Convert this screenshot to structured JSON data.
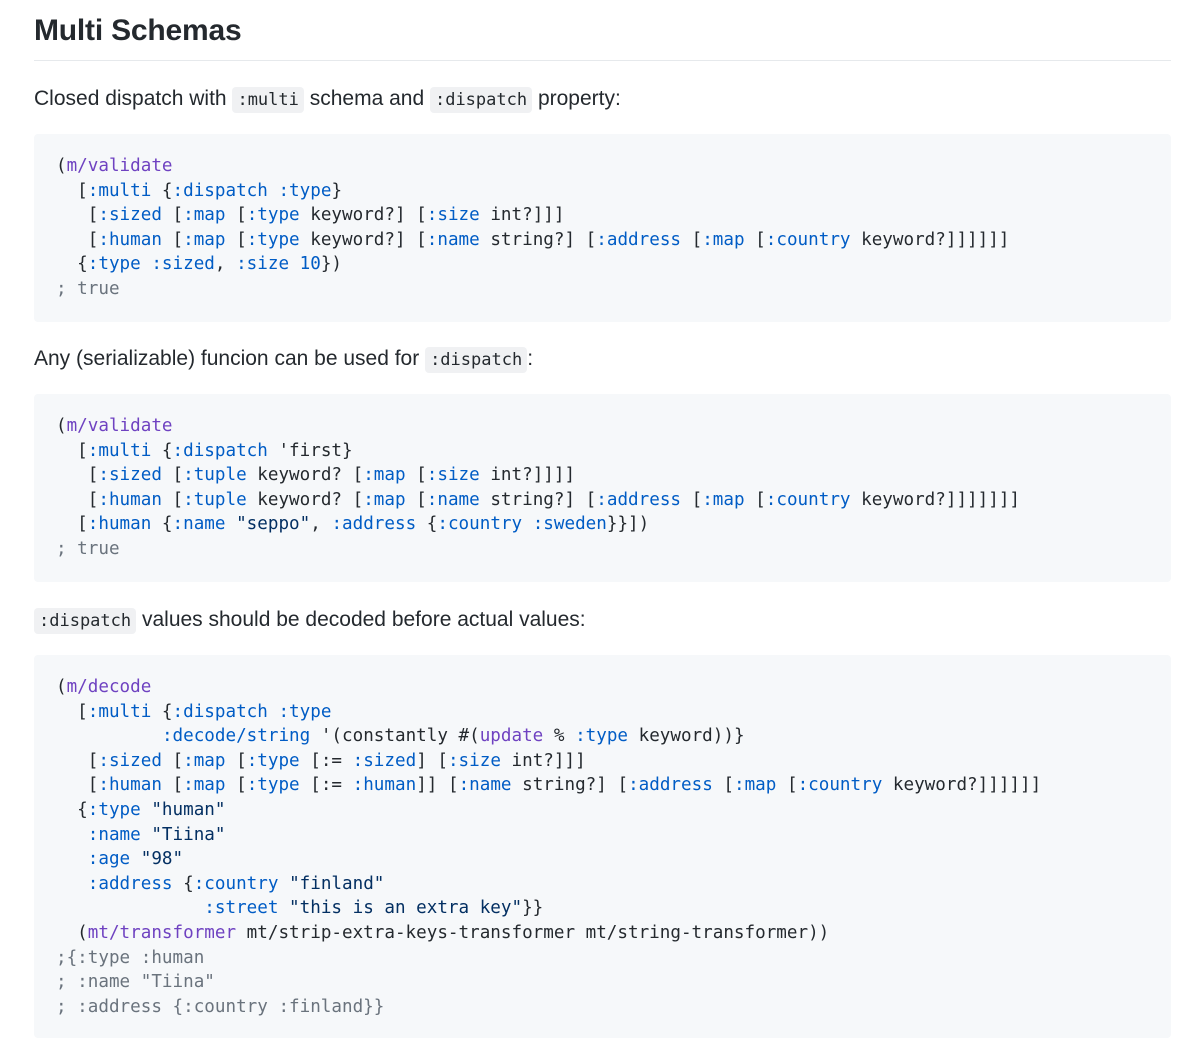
{
  "heading": "Multi Schemas",
  "para1": {
    "before": "Closed dispatch with",
    "code1": ":multi",
    "middle": "schema and",
    "code2": ":dispatch",
    "after": "property:"
  },
  "para2": {
    "before": "Any (serializable) funcion can be used for",
    "code1": ":dispatch",
    "after": ":"
  },
  "para3": {
    "code1": ":dispatch",
    "after": "values should be decoded before actual values:"
  },
  "code_blocks": [
    {
      "lines": [
        [
          [
            "p",
            "("
          ],
          [
            "f",
            "m/validate"
          ]
        ],
        [
          [
            "p",
            "  ["
          ],
          [
            "k",
            ":multi"
          ],
          [
            "p",
            " {"
          ],
          [
            "k",
            ":dispatch"
          ],
          [
            "p",
            " "
          ],
          [
            "k",
            ":type"
          ],
          [
            "p",
            "}"
          ]
        ],
        [
          [
            "p",
            "   ["
          ],
          [
            "k",
            ":sized"
          ],
          [
            "p",
            " ["
          ],
          [
            "k",
            ":map"
          ],
          [
            "p",
            " ["
          ],
          [
            "k",
            ":type"
          ],
          [
            "p",
            " keyword?] ["
          ],
          [
            "k",
            ":size"
          ],
          [
            "p",
            " int?]]]"
          ]
        ],
        [
          [
            "p",
            "   ["
          ],
          [
            "k",
            ":human"
          ],
          [
            "p",
            " ["
          ],
          [
            "k",
            ":map"
          ],
          [
            "p",
            " ["
          ],
          [
            "k",
            ":type"
          ],
          [
            "p",
            " keyword?] ["
          ],
          [
            "k",
            ":name"
          ],
          [
            "p",
            " string?] ["
          ],
          [
            "k",
            ":address"
          ],
          [
            "p",
            " ["
          ],
          [
            "k",
            ":map"
          ],
          [
            "p",
            " ["
          ],
          [
            "k",
            ":country"
          ],
          [
            "p",
            " keyword?]]]]]]"
          ]
        ],
        [
          [
            "p",
            "  {"
          ],
          [
            "k",
            ":type"
          ],
          [
            "p",
            " "
          ],
          [
            "k",
            ":sized"
          ],
          [
            "p",
            ", "
          ],
          [
            "k",
            ":size"
          ],
          [
            "p",
            " "
          ],
          [
            "n",
            "10"
          ],
          [
            "p",
            "})"
          ]
        ],
        [
          [
            "c",
            "; true"
          ]
        ]
      ]
    },
    {
      "lines": [
        [
          [
            "p",
            "("
          ],
          [
            "f",
            "m/validate"
          ]
        ],
        [
          [
            "p",
            "  ["
          ],
          [
            "k",
            ":multi"
          ],
          [
            "p",
            " {"
          ],
          [
            "k",
            ":dispatch"
          ],
          [
            "p",
            " 'first}"
          ]
        ],
        [
          [
            "p",
            "   ["
          ],
          [
            "k",
            ":sized"
          ],
          [
            "p",
            " ["
          ],
          [
            "k",
            ":tuple"
          ],
          [
            "p",
            " keyword? ["
          ],
          [
            "k",
            ":map"
          ],
          [
            "p",
            " ["
          ],
          [
            "k",
            ":size"
          ],
          [
            "p",
            " int?]]]]"
          ]
        ],
        [
          [
            "p",
            "   ["
          ],
          [
            "k",
            ":human"
          ],
          [
            "p",
            " ["
          ],
          [
            "k",
            ":tuple"
          ],
          [
            "p",
            " keyword? ["
          ],
          [
            "k",
            ":map"
          ],
          [
            "p",
            " ["
          ],
          [
            "k",
            ":name"
          ],
          [
            "p",
            " string?] ["
          ],
          [
            "k",
            ":address"
          ],
          [
            "p",
            " ["
          ],
          [
            "k",
            ":map"
          ],
          [
            "p",
            " ["
          ],
          [
            "k",
            ":country"
          ],
          [
            "p",
            " keyword?]]]]]]]"
          ]
        ],
        [
          [
            "p",
            "  ["
          ],
          [
            "k",
            ":human"
          ],
          [
            "p",
            " {"
          ],
          [
            "k",
            ":name"
          ],
          [
            "p",
            " "
          ],
          [
            "s",
            "\"seppo\""
          ],
          [
            "p",
            ", "
          ],
          [
            "k",
            ":address"
          ],
          [
            "p",
            " {"
          ],
          [
            "k",
            ":country"
          ],
          [
            "p",
            " "
          ],
          [
            "k",
            ":sweden"
          ],
          [
            "p",
            "}}])"
          ]
        ],
        [
          [
            "c",
            "; true"
          ]
        ]
      ]
    },
    {
      "lines": [
        [
          [
            "p",
            "("
          ],
          [
            "f",
            "m/decode"
          ]
        ],
        [
          [
            "p",
            "  ["
          ],
          [
            "k",
            ":multi"
          ],
          [
            "p",
            " {"
          ],
          [
            "k",
            ":dispatch"
          ],
          [
            "p",
            " "
          ],
          [
            "k",
            ":type"
          ]
        ],
        [
          [
            "p",
            "          "
          ],
          [
            "k",
            ":decode/string"
          ],
          [
            "p",
            " '(constantly #("
          ],
          [
            "f",
            "update"
          ],
          [
            "p",
            " % "
          ],
          [
            "k",
            ":type"
          ],
          [
            "p",
            " keyword))}"
          ]
        ],
        [
          [
            "p",
            "   ["
          ],
          [
            "k",
            ":sized"
          ],
          [
            "p",
            " ["
          ],
          [
            "k",
            ":map"
          ],
          [
            "p",
            " ["
          ],
          [
            "k",
            ":type"
          ],
          [
            "p",
            " [:= "
          ],
          [
            "k",
            ":sized"
          ],
          [
            "p",
            "] ["
          ],
          [
            "k",
            ":size"
          ],
          [
            "p",
            " int?]]]"
          ]
        ],
        [
          [
            "p",
            "   ["
          ],
          [
            "k",
            ":human"
          ],
          [
            "p",
            " ["
          ],
          [
            "k",
            ":map"
          ],
          [
            "p",
            " ["
          ],
          [
            "k",
            ":type"
          ],
          [
            "p",
            " [:= "
          ],
          [
            "k",
            ":human"
          ],
          [
            "p",
            "]] ["
          ],
          [
            "k",
            ":name"
          ],
          [
            "p",
            " string?] ["
          ],
          [
            "k",
            ":address"
          ],
          [
            "p",
            " ["
          ],
          [
            "k",
            ":map"
          ],
          [
            "p",
            " ["
          ],
          [
            "k",
            ":country"
          ],
          [
            "p",
            " keyword?]]]]]]"
          ]
        ],
        [
          [
            "p",
            "  {"
          ],
          [
            "k",
            ":type"
          ],
          [
            "p",
            " "
          ],
          [
            "s",
            "\"human\""
          ]
        ],
        [
          [
            "p",
            "   "
          ],
          [
            "k",
            ":name"
          ],
          [
            "p",
            " "
          ],
          [
            "s",
            "\"Tiina\""
          ]
        ],
        [
          [
            "p",
            "   "
          ],
          [
            "k",
            ":age"
          ],
          [
            "p",
            " "
          ],
          [
            "s",
            "\"98\""
          ]
        ],
        [
          [
            "p",
            "   "
          ],
          [
            "k",
            ":address"
          ],
          [
            "p",
            " {"
          ],
          [
            "k",
            ":country"
          ],
          [
            "p",
            " "
          ],
          [
            "s",
            "\"finland\""
          ]
        ],
        [
          [
            "p",
            "              "
          ],
          [
            "k",
            ":street"
          ],
          [
            "p",
            " "
          ],
          [
            "s",
            "\"this is an extra key\""
          ],
          [
            "p",
            "}}"
          ]
        ],
        [
          [
            "p",
            "  ("
          ],
          [
            "f",
            "mt/transformer"
          ],
          [
            "p",
            " mt/strip-extra-keys-transformer mt/string-transformer))"
          ]
        ],
        [
          [
            "c",
            ";{:type :human"
          ]
        ],
        [
          [
            "c",
            "; :name \"Tiina\""
          ]
        ],
        [
          [
            "c",
            "; :address {:country :finland}}"
          ]
        ]
      ]
    }
  ]
}
